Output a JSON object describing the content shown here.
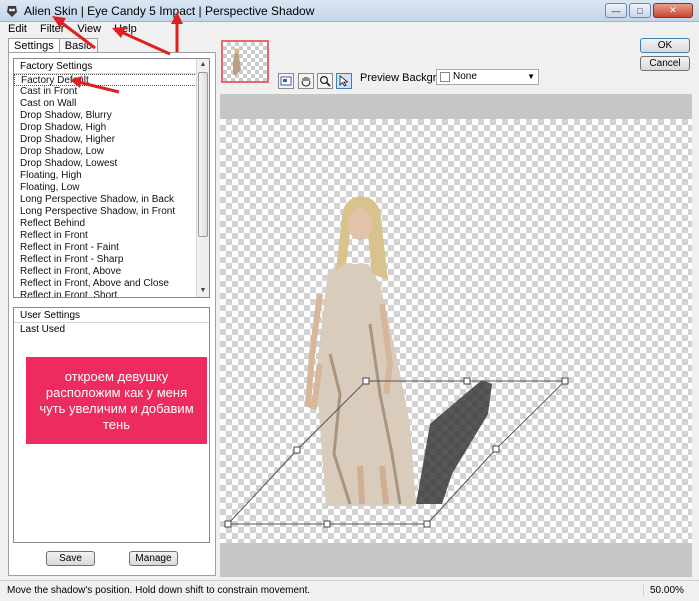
{
  "window": {
    "title": "Alien Skin | Eye Candy 5 Impact | Perspective Shadow",
    "controls": [
      "minimize-icon",
      "maximize-icon",
      "close-icon"
    ]
  },
  "menu": [
    "Edit",
    "Filter",
    "View",
    "Help"
  ],
  "tabs": [
    "Settings",
    "Basic"
  ],
  "factory": {
    "header": "Factory Settings",
    "items": [
      "Factory Default",
      "Cast in Front",
      "Cast on Wall",
      "Drop Shadow, Blurry",
      "Drop Shadow, High",
      "Drop Shadow, Higher",
      "Drop Shadow, Low",
      "Drop Shadow, Lowest",
      "Floating, High",
      "Floating, Low",
      "Long Perspective Shadow, in Back",
      "Long Perspective Shadow, in Front",
      "Reflect Behind",
      "Reflect in Front",
      "Reflect in Front - Faint",
      "Reflect in Front - Sharp",
      "Reflect in Front, Above",
      "Reflect in Front, Above and Close",
      "Reflect in Front, Short"
    ]
  },
  "user": {
    "header": "User Settings",
    "items": [
      "Last Used"
    ]
  },
  "annotation": "откроем девушку расположим как у меня чуть увеличим и добавим тень",
  "buttons": {
    "save": "Save",
    "manage": "Manage",
    "ok": "OK",
    "cancel": "Cancel"
  },
  "tools": [
    "navigator-icon",
    "hand-icon",
    "zoom-icon",
    "arrow-pointer-icon"
  ],
  "preview": {
    "label": "Preview Background:",
    "value": "None"
  },
  "status": {
    "message": "Move the shadow's position. Hold down shift to constrain movement.",
    "zoom": "50.00%"
  },
  "colors": {
    "annotation": "#ee2b5e",
    "arrows": "#e02020",
    "selection": "#e46b6b"
  }
}
